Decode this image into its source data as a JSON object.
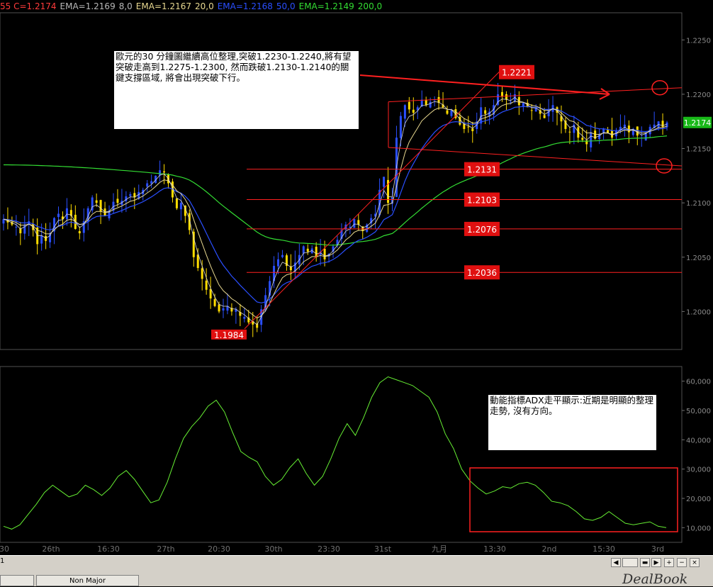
{
  "header": {
    "items": [
      {
        "text": "55 C=1.2174",
        "color": "#ff3b3b"
      },
      {
        "text": "EMA=1.2169",
        "color": "#b8b8b8"
      },
      {
        "text": "8,0",
        "color": "#b8b8b8"
      },
      {
        "text": "EMA=1.2167",
        "color": "#e8d890"
      },
      {
        "text": "20,0",
        "color": "#e8d890"
      },
      {
        "text": "EMA=1.2168",
        "color": "#2a4fff"
      },
      {
        "text": "50,0",
        "color": "#2a4fff"
      },
      {
        "text": "EMA=1.2149",
        "color": "#33dd33"
      },
      {
        "text": "200,0",
        "color": "#33dd33"
      }
    ]
  },
  "annotations": {
    "main_note": "歐元的30 分鐘圖繼續高位整理,突破1.2230-1.2240,將有望突破走高到1.2275-1.2300, 然而跌破1.2130-1.2140的關鍵支撐區域, 將會出現突破下行。",
    "adx_note": "動能指標ADX走平顯示:近期是明顯的整理走勢, 沒有方向。"
  },
  "price_labels": {
    "high": "1.2221",
    "low": "1.1984",
    "levels": [
      "1.2131",
      "1.2103",
      "1.2076",
      "1.2036"
    ],
    "current": "1.2174"
  },
  "axis": {
    "price_ticks": [
      "1.2250",
      "1.2200",
      "1.2150",
      "1.2100",
      "1.2050",
      "1.2000"
    ],
    "adx_ticks": [
      "60,000",
      "50,000",
      "40,000",
      "30,000",
      "20,000",
      "10,000"
    ],
    "time_ticks": [
      "30",
      "26th",
      "16:30",
      "27th",
      "20:30",
      "30th",
      "23:30",
      "31st",
      "九月",
      "13:30",
      "2nd",
      "15:30",
      "3rd"
    ]
  },
  "bottom": {
    "pane_number": "1",
    "tab_label": "Non Major",
    "brand": "DealBook"
  },
  "colors": {
    "background": "#000000",
    "candle_up": "#2a4fff",
    "candle_down": "#ffdd00",
    "ema8": "#d8d8d8",
    "ema20": "#e8d890",
    "ema50": "#2a4fff",
    "ema200": "#33dd33",
    "adx": "#66ee33",
    "annotation_red": "#ff2020"
  },
  "chart_data": [
    {
      "type": "candlestick",
      "ylim": [
        1.1965,
        1.2275
      ],
      "support_resistance_levels": [
        1.2131,
        1.2103,
        1.2076,
        1.2036
      ],
      "swing_low": 1.1984,
      "swing_high": 1.2221,
      "last_close": 1.2174,
      "close_path": [
        1.2085,
        1.2082,
        1.208,
        1.2078,
        1.2072,
        1.208,
        1.2083,
        1.2075,
        1.2062,
        1.207,
        1.2065,
        1.2072,
        1.2086,
        1.209,
        1.2085,
        1.2095,
        1.2088,
        1.2076,
        1.2072,
        1.2083,
        1.2095,
        1.2105,
        1.21,
        1.2092,
        1.2088,
        1.2093,
        1.2101,
        1.21,
        1.2102,
        1.2106,
        1.2108,
        1.2105,
        1.211,
        1.2112,
        1.2118,
        1.212,
        1.2125,
        1.213,
        1.2128,
        1.2118,
        1.2105,
        1.2095,
        1.21,
        1.2088,
        1.2075,
        1.205,
        1.204,
        1.203,
        1.202,
        1.2012,
        1.2005,
        1.2,
        1.2003,
        1.2005,
        1.2,
        1.2002,
        1.1996,
        1.1995,
        1.199,
        1.1988,
        1.1985,
        1.2002,
        1.2015,
        1.2028,
        1.2042,
        1.2048,
        1.2052,
        1.2042,
        1.2038,
        1.2045,
        1.2052,
        1.206,
        1.2055,
        1.2058,
        1.205,
        1.2055,
        1.2048,
        1.2053,
        1.206,
        1.2066,
        1.2075,
        1.208,
        1.2078,
        1.2085,
        1.208,
        1.2074,
        1.208,
        1.2086,
        1.209,
        1.2112,
        1.2124,
        1.21,
        1.2105,
        1.216,
        1.218,
        1.219,
        1.2186,
        1.2183,
        1.2188,
        1.2195,
        1.219,
        1.2193,
        1.2195,
        1.2192,
        1.2188,
        1.2182,
        1.2185,
        1.2178,
        1.2172,
        1.2168,
        1.217,
        1.2166,
        1.2175,
        1.2188,
        1.2182,
        1.2184,
        1.219,
        1.22,
        1.2198,
        1.2195,
        1.2193,
        1.22,
        1.219,
        1.2192,
        1.2188,
        1.2185,
        1.2187,
        1.2182,
        1.2178,
        1.2186,
        1.219,
        1.2183,
        1.2175,
        1.2168,
        1.2165,
        1.2172,
        1.216,
        1.2158,
        1.2154,
        1.2165,
        1.2159,
        1.2163,
        1.2168,
        1.2164,
        1.216,
        1.2166,
        1.217,
        1.2172,
        1.2165,
        1.2168,
        1.2162,
        1.216,
        1.2165,
        1.217,
        1.2172,
        1.2175,
        1.217,
        1.2174
      ]
    },
    {
      "type": "line",
      "name": "ADX",
      "ylim": [
        5000,
        65000
      ],
      "values": [
        10500,
        9500,
        11000,
        14500,
        18000,
        22000,
        24500,
        22500,
        20500,
        21500,
        24500,
        23000,
        21000,
        23500,
        27500,
        29500,
        26500,
        22500,
        18500,
        19500,
        25500,
        33500,
        40500,
        44500,
        47500,
        51500,
        53500,
        49500,
        42500,
        36000,
        34000,
        32500,
        27500,
        24500,
        26500,
        30500,
        33500,
        28500,
        24500,
        27500,
        33500,
        40500,
        45500,
        41500,
        47500,
        54500,
        59500,
        61500,
        60500,
        59500,
        58500,
        56500,
        54500,
        49500,
        42000,
        37000,
        30000,
        26000,
        23500,
        21500,
        22500,
        24000,
        23500,
        25000,
        25500,
        24500,
        22000,
        19000,
        18500,
        17500,
        15500,
        13000,
        12500,
        13500,
        15500,
        13500,
        11500,
        11000,
        11500,
        12000,
        10500,
        10000
      ]
    }
  ]
}
